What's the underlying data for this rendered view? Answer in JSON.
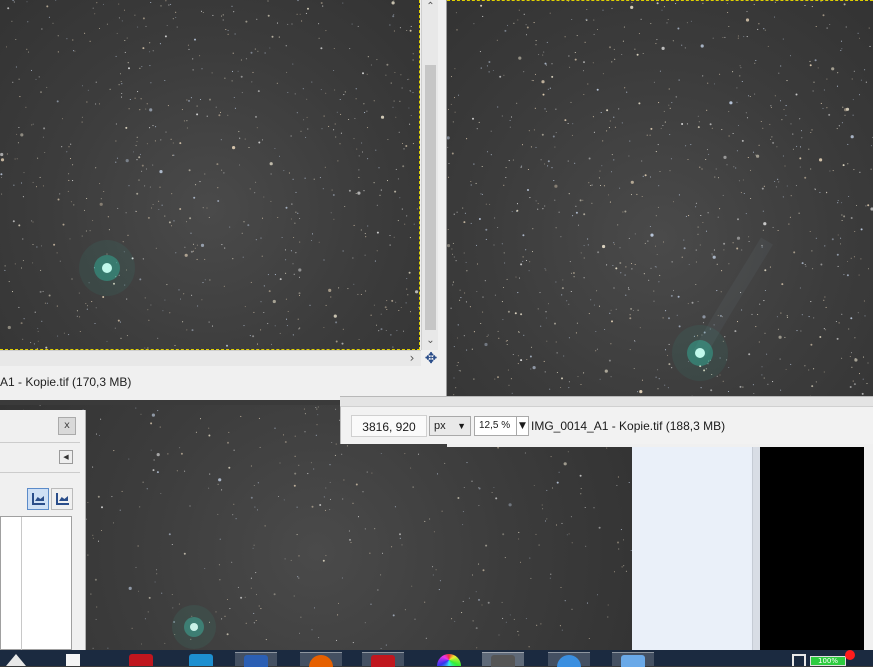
{
  "window_left": {
    "status_text": "A1 - Kopie.tif (170,3 MB)"
  },
  "window_right": {
    "coords": "3816, 920",
    "unit": "px",
    "zoom": "12,5 %",
    "status_text": "IMG_0014_A1 - Kopie.tif (188,3 MB)"
  },
  "panel": {
    "close_label": "x"
  },
  "taskbar": {
    "battery_text": "100%",
    "apps": [
      "app-red",
      "app-blue",
      "word",
      "firefox",
      "app-red-2",
      "color-wheel",
      "app-gray",
      "app-blue-circle",
      "app-window"
    ]
  },
  "colors": {
    "comet": "#2fd6b8",
    "selection_marquee": "#e0d000",
    "taskbar": "#1b2a40"
  }
}
